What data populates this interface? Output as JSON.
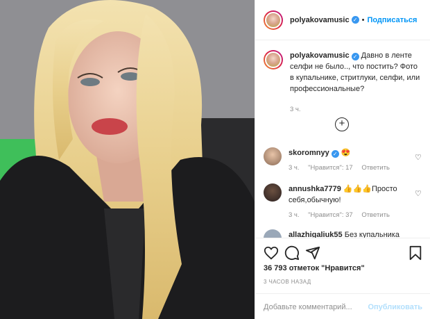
{
  "post": {
    "image_alt": "selfie photo",
    "colors": {
      "accent": "#0095f6",
      "verified": "#3897f0",
      "muted": "#8e8e8e"
    }
  },
  "header": {
    "username": "polyakovamusic",
    "separator": "•",
    "follow_label": "Подписаться"
  },
  "caption": {
    "username": "polyakovamusic",
    "text": "Давно в ленте селфи не было.., что постить? Фото в купальнике, стритлуки, селфи, или профессиональные?",
    "time": "3 ч."
  },
  "load_more_icon": "plus-circle-icon",
  "comments": [
    {
      "username": "skoromnyy",
      "text": "😍",
      "time": "3 ч.",
      "likes": "\"Нравится\": 17",
      "reply": "Ответить"
    },
    {
      "username": "annushka7779",
      "text": "👍👍👍Просто себя,обычную!",
      "time": "3 ч.",
      "likes": "\"Нравится\": 37",
      "reply": "Ответить"
    },
    {
      "username": "allazhigaliuk55",
      "text": "Без купальника",
      "time": "",
      "likes": "",
      "reply": ""
    }
  ],
  "actions": {
    "icons": [
      "heart-icon",
      "comment-icon",
      "share-icon",
      "bookmark-icon"
    ],
    "likes_text": "36 793 отметок \"Нравится\"",
    "timestamp": "3 ЧАСОВ НАЗАД"
  },
  "add_comment": {
    "placeholder": "Добавьте комментарий...",
    "publish_label": "Опубликовать"
  }
}
